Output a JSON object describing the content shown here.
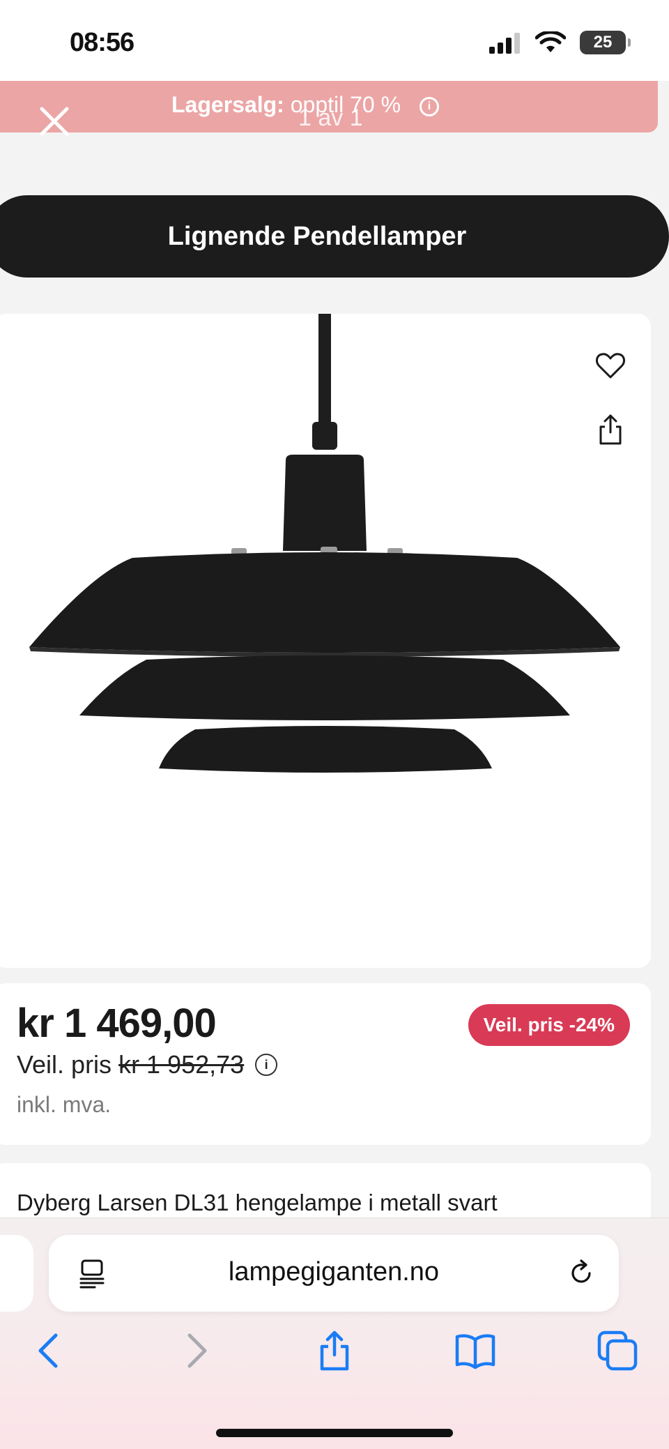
{
  "status_bar": {
    "time": "08:56",
    "battery": "25"
  },
  "promo": {
    "label": "Lagersalg:",
    "text": " opptil 70 %",
    "info_icon": "info-icon"
  },
  "gallery": {
    "counter": "1 av 1",
    "close_icon": "close-icon"
  },
  "similar": {
    "label": "Lignende Pendellamper"
  },
  "product_image": {
    "alt": "black three-tier pendant lamp",
    "favorite_icon": "heart-icon",
    "share_icon": "share-icon"
  },
  "price": {
    "current": "kr 1 469,00",
    "badge": "Veil. pris -24%",
    "rrp_label": "Veil. pris",
    "rrp_value": "kr 1 952,73",
    "vat_note": "inkl. mva."
  },
  "description": {
    "title": "Dyberg Larsen DL31 hengelampe i metall svart"
  },
  "browser": {
    "url": "lampegiganten.no",
    "accent": "#1a7cf5",
    "icons": [
      "reader-icon",
      "reload-icon",
      "back-icon",
      "forward-icon",
      "share-icon",
      "bookmarks-icon",
      "tabs-icon"
    ]
  }
}
